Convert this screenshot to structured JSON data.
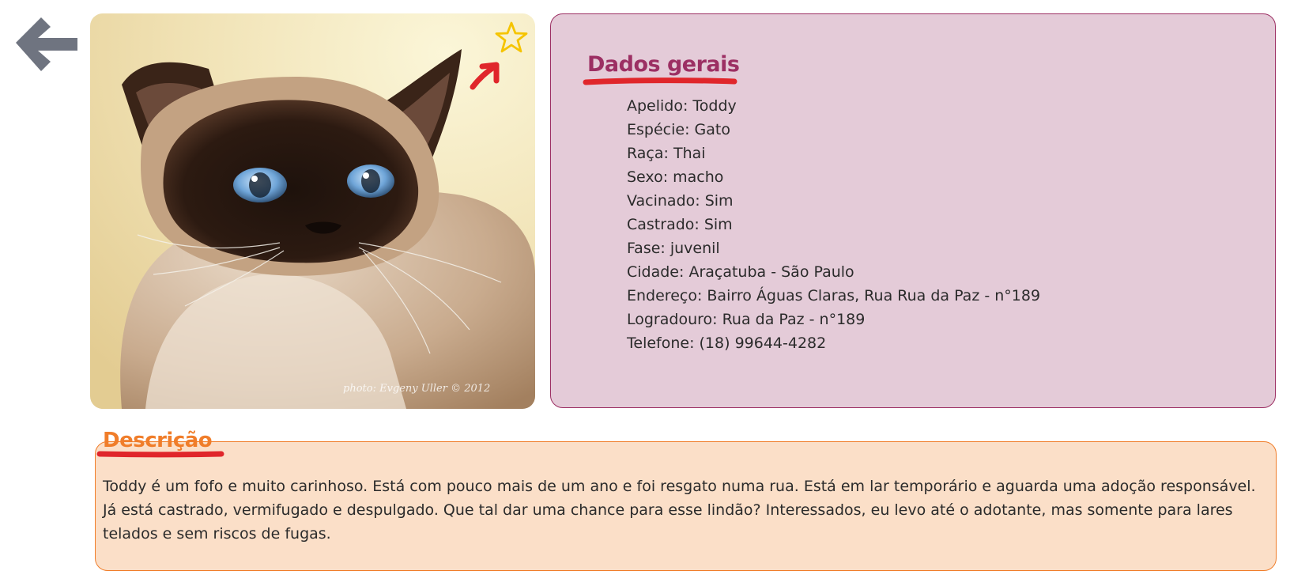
{
  "header": {
    "back_icon": "arrow-left-icon",
    "favorite_icon": "star-outline-icon"
  },
  "photo": {
    "caption": "photo: Evgeny Uller © 2012"
  },
  "info": {
    "title": "Dados gerais",
    "items": [
      "Apelido: Toddy",
      "Espécie: Gato",
      "Raça: Thai",
      "Sexo: macho",
      "Vacinado: Sim",
      "Castrado: Sim",
      "Fase: juvenil",
      "Cidade: Araçatuba - São Paulo",
      "Endereço: Bairro Águas Claras, Rua Rua da Paz - n°189",
      "Logradouro: Rua da Paz - n°189",
      "Telefone: (18) 99644-4282"
    ]
  },
  "description": {
    "title": "Descrição",
    "text": "Toddy é um fofo e muito carinhoso. Está com pouco mais de um ano e foi resgato numa rua. Está em lar temporário e aguarda uma adoção responsável. Já está castrado, vermifugado e despulgado. Que tal dar uma chance para esse lindão? Interessados, eu levo até o adotante, mas somente para lares telados e sem riscos de fugas."
  },
  "colors": {
    "info_bg": "#e4cbd8",
    "info_accent": "#9c2f63",
    "desc_bg": "#fbdfc8",
    "desc_accent": "#f07d2a",
    "underline": "#e0262b",
    "icon_gray": "#6f7480",
    "star": "#f5c400"
  }
}
